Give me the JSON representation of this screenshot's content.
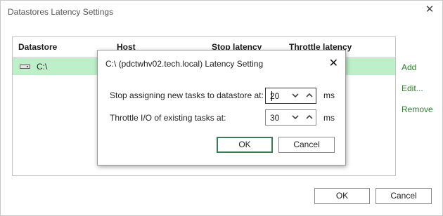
{
  "window": {
    "title": "Datastores Latency Settings",
    "close_icon": "close-icon"
  },
  "grid": {
    "columns": [
      "Datastore",
      "Host",
      "Stop latency",
      "Throttle latency"
    ],
    "rows": [
      {
        "datastore": "C:\\",
        "icon": "disk-icon"
      }
    ],
    "selected_row_color": "#bdf0c8"
  },
  "side_actions": {
    "add": "Add",
    "edit": "Edit...",
    "remove": "Remove",
    "link_color": "#2e7d32"
  },
  "footer": {
    "ok": "OK",
    "cancel": "Cancel"
  },
  "modal": {
    "title": "C:\\ (pdctwhv02.tech.local) Latency Setting",
    "stop_label": "Stop assigning new tasks to datastore at:",
    "stop_value": "20",
    "stop_unit": "ms",
    "throttle_label": "Throttle I/O of existing tasks at:",
    "throttle_value": "30",
    "throttle_unit": "ms",
    "ok": "OK",
    "cancel": "Cancel"
  }
}
